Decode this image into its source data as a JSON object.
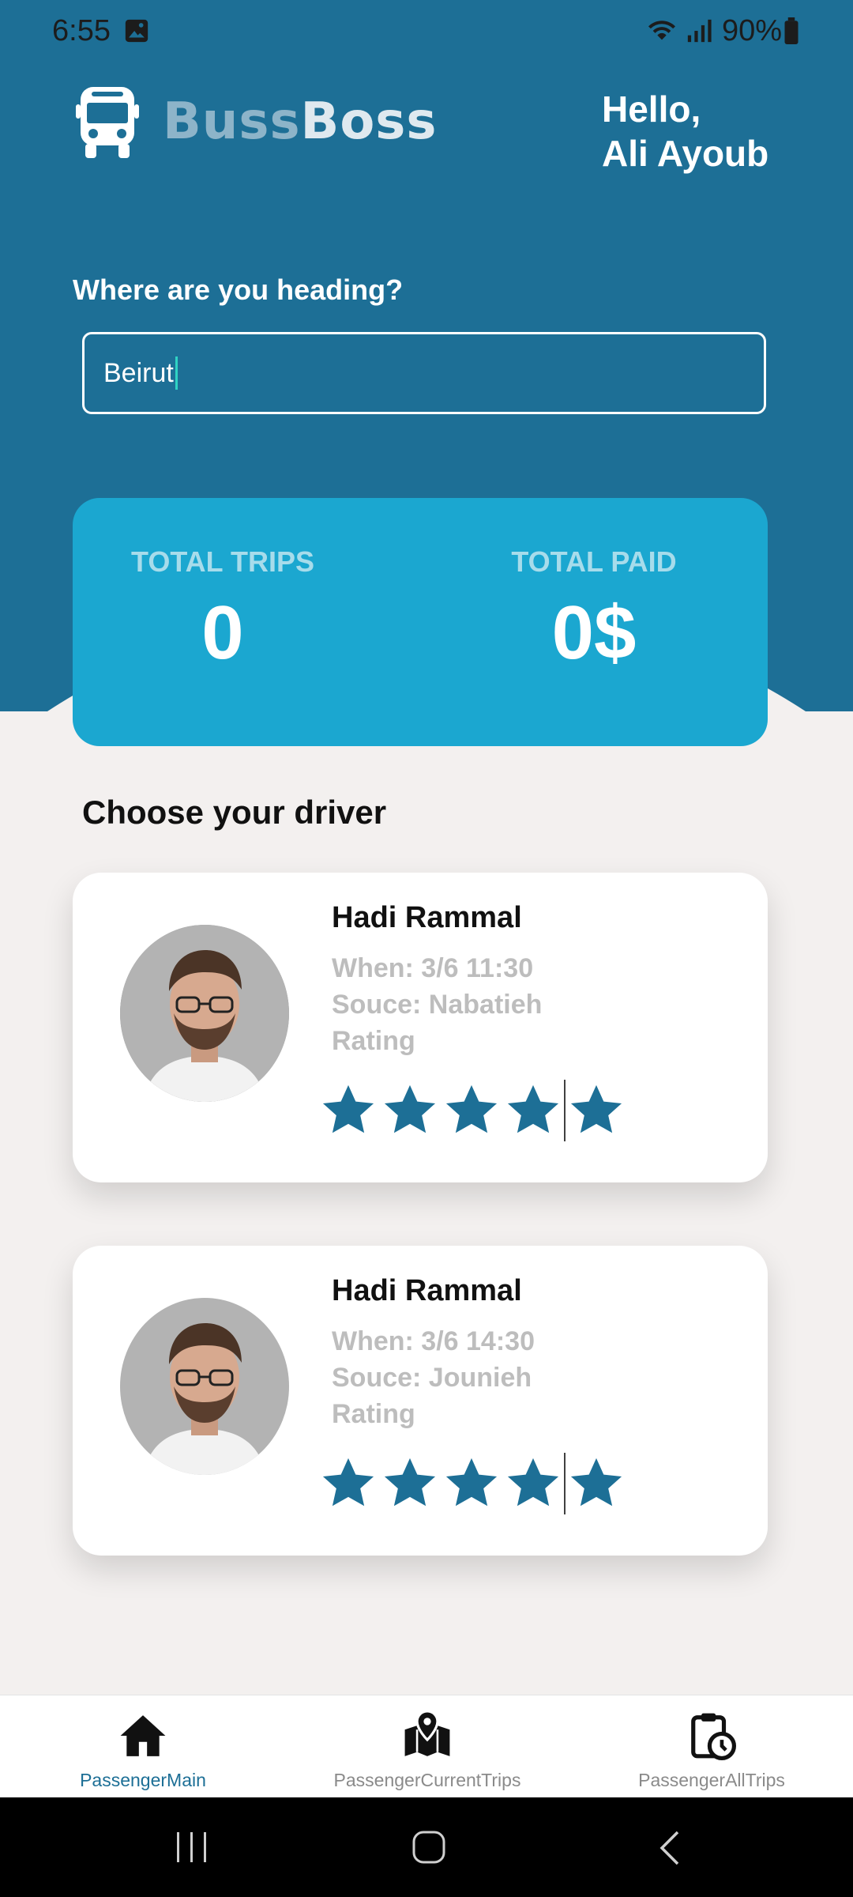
{
  "status_bar": {
    "time": "6:55",
    "battery": "90%",
    "icons": [
      "image-icon",
      "wifi-icon",
      "signal-icon",
      "battery-icon"
    ]
  },
  "app": {
    "logo_part1": "Buss",
    "logo_part2": "Boss",
    "logo_icon": "bus-icon"
  },
  "greeting": {
    "line1": "Hello,",
    "line2": "Ali Ayoub"
  },
  "search": {
    "label": "Where are you heading?",
    "value": "Beirut"
  },
  "stats": {
    "trips_label": "TOTAL TRIPS",
    "trips_value": "0",
    "paid_label": "TOTAL PAID",
    "paid_value": "0$"
  },
  "drivers_title": "Choose your driver",
  "drivers": [
    {
      "name": "Hadi Rammal",
      "when": "When: 3/6 11:30",
      "source": "Souce: Nabatieh",
      "rating_label": "Rating",
      "stars": 5
    },
    {
      "name": "Hadi Rammal",
      "when": "When: 3/6 14:30",
      "source": "Souce: Jounieh",
      "rating_label": "Rating",
      "stars": 5
    }
  ],
  "bottom_nav": [
    {
      "label": "PassengerMain",
      "icon": "home-icon",
      "active": true
    },
    {
      "label": "PassengerCurrentTrips",
      "icon": "map-pin-icon",
      "active": false
    },
    {
      "label": "PassengerAllTrips",
      "icon": "clipboard-clock-icon",
      "active": false
    }
  ],
  "colors": {
    "primary": "#1d6f96",
    "card": "#1ba7d0",
    "background": "#f3f0ef",
    "star": "#1d6f96"
  }
}
